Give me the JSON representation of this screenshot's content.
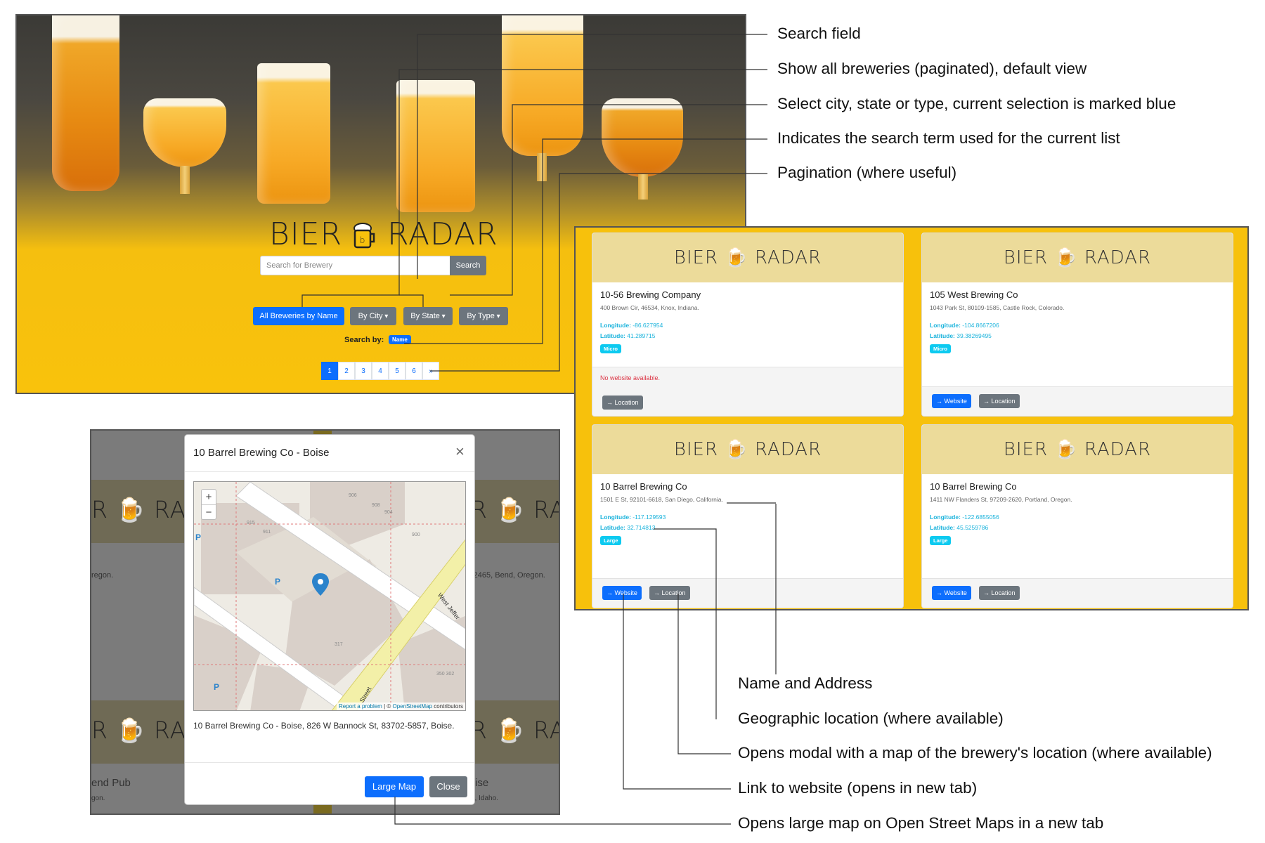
{
  "hero": {
    "logo_left": "BIER",
    "logo_right": "RADAR",
    "search_placeholder": "Search for Brewery",
    "search_button": "Search",
    "btn_all": "All Breweries by Name",
    "btn_city": "By City",
    "btn_state": "By State",
    "btn_type": "By Type",
    "search_by_label": "Search by:",
    "search_by_value": "Name",
    "pages": [
      "1",
      "2",
      "3",
      "4",
      "5",
      "6",
      "»"
    ]
  },
  "cards": [
    {
      "logo_left": "BIER",
      "logo_right": "RADAR",
      "name": "10-56 Brewing Company",
      "address": "400 Brown Cir, 46534, Knox, Indiana.",
      "lon_label": "Longitude:",
      "lon": "-86.627954",
      "lat_label": "Latitude:",
      "lat": "41.289715",
      "type": "Micro",
      "no_website": "No website available.",
      "location_btn": "→ Location"
    },
    {
      "logo_left": "BIER",
      "logo_right": "RADAR",
      "name": "105 West Brewing Co",
      "address": "1043 Park St, 80109-1585, Castle Rock, Colorado.",
      "lon_label": "Longitude:",
      "lon": "-104.8667206",
      "lat_label": "Latitude:",
      "lat": "39.38269495",
      "type": "Micro",
      "website_btn": "→ Website",
      "location_btn": "→ Location"
    },
    {
      "logo_left": "BIER",
      "logo_right": "RADAR",
      "name": "10 Barrel Brewing Co",
      "address": "1501 E St, 92101-6618, San Diego, California.",
      "lon_label": "Longitude:",
      "lon": "-117.129593",
      "lat_label": "Latitude:",
      "lat": "32.714813",
      "type": "Large",
      "website_btn": "→ Website",
      "location_btn": "→ Location"
    },
    {
      "logo_left": "BIER",
      "logo_right": "RADAR",
      "name": "10 Barrel Brewing Co",
      "address": "1411 NW Flanders St, 97209-2620, Portland, Oregon.",
      "lon_label": "Longitude:",
      "lon": "-122.6855056",
      "lat_label": "Latitude:",
      "lat": "45.5259786",
      "type": "Large",
      "website_btn": "→ Website",
      "location_btn": "→ Location"
    }
  ],
  "backdrop": {
    "logo_fragment_a": "R",
    "logo_fragment_b": "RADA",
    "logo_fragment_c": "R",
    "logo_fragment_d": "RAD",
    "text_oregon": "regon.",
    "text_bend": "-2465, Bend, Oregon.",
    "text_pub": "end Pub",
    "text_gon": "gon.",
    "text_ise": "ise",
    "text_idaho": "e, Idaho."
  },
  "modal": {
    "title": "10 Barrel Brewing Co - Boise",
    "close": "×",
    "zoom_in": "+",
    "zoom_out": "−",
    "map_attribution_link": "Report a problem",
    "map_attribution_sep": " | © ",
    "map_attribution_osm": "OpenStreetMap",
    "map_attribution_tail": " contributors",
    "street_a": "West Jeffer",
    "street_b": "Street",
    "address": "10 Barrel Brewing Co - Boise, 826 W Bannock St, 83702-5857, Boise.",
    "large_map_btn": "Large Map",
    "close_btn": "Close",
    "map_numbers": [
      "906",
      "908",
      "904",
      "915",
      "911",
      "900",
      "317",
      "350 302"
    ],
    "parking": "P"
  },
  "annotations": {
    "search_field": "Search field",
    "show_all": "Show all breweries (paginated), default view",
    "select": "Select city, state or type, current selection is marked blue",
    "indicates": "Indicates the search term used for the current list",
    "pagination": "Pagination (where useful)",
    "name_address": "Name and Address",
    "geo": "Geographic location (where available)",
    "opens_modal": "Opens modal with a map of the brewery's location (where available)",
    "link_website": "Link to website (opens in new tab)",
    "large_map": "Opens large map on Open Street Maps in a new tab"
  },
  "colors": {
    "primary": "#0d6efd",
    "secondary": "#6c757d",
    "brand_yellow": "#f7c10c",
    "info": "#0dcaf0"
  }
}
